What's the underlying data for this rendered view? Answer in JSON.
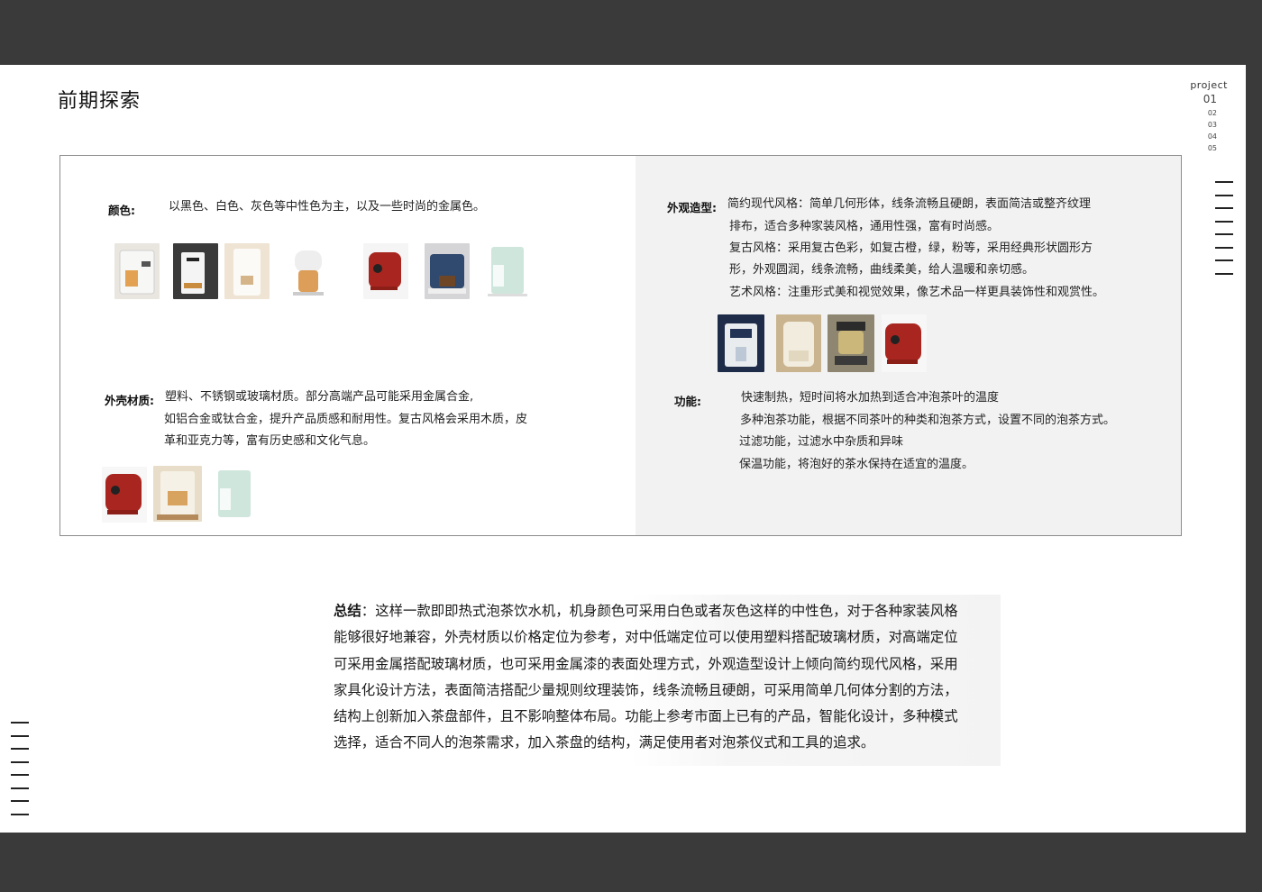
{
  "page": {
    "title": "前期探索"
  },
  "nav": {
    "label": "project",
    "numbers": [
      "01",
      "02",
      "03",
      "04",
      "05"
    ],
    "active": "01"
  },
  "color_section": {
    "label": "颜色:",
    "text": "以黑色、白色、灰色等中性色为主，以及一些时尚的金属色。"
  },
  "shell_section": {
    "label": "外壳材质:",
    "lines": [
      "塑料、不锈钢或玻璃材质。部分高端产品可能采用金属合金,",
      "如铝合金或钛合金，提升产品质感和耐用性。复古风格会采用木质，皮",
      "革和亚克力等，富有历史感和文化气息。"
    ]
  },
  "shape_section": {
    "label": "外观造型:",
    "lines": [
      "简约现代风格：简单几何形体，线条流畅且硬朗，表面简洁或整齐纹理",
      "排布，适合多种家装风格，通用性强，富有时尚感。",
      "复古风格：采用复古色彩，如复古橙，绿，粉等，采用经典形状圆形方",
      "形，外观圆润，线条流畅，曲线柔美，给人温暖和亲切感。",
      "艺术风格：注重形式美和视觉效果，像艺术品一样更具装饰性和观赏性。"
    ]
  },
  "function_section": {
    "label": "功能:",
    "lines": [
      "快速制热，短时间将水加热到适合冲泡茶叶的温度",
      "多种泡茶功能，根据不同茶叶的种类和泡茶方式，设置不同的泡茶方式。",
      "过滤功能，过滤水中杂质和异味",
      "保温功能，将泡好的茶水保持在适宜的温度。"
    ]
  },
  "summary": {
    "label": "总结",
    "lines": [
      "：这样一款即即热式泡茶饮水机，机身颜色可采用白色或者灰色这样的中性色，对于各种家装风格",
      "能够很好地兼容，外壳材质以价格定位为参考，对中低端定位可以使用塑料搭配玻璃材质，对高端定位",
      "可采用金属搭配玻璃材质，也可采用金属漆的表面处理方式，外观造型设计上倾向简约现代风格，采用",
      "家具化设计方法，表面简洁搭配少量规则纹理装饰，线条流畅且硬朗，可采用简单几何体分割的方法，",
      "结构上创新加入茶盘部件，且不影响整体布局。功能上参考市面上已有的产品，智能化设计，多种模式",
      "选择，适合不同人的泡茶需求，加入茶盘的结构，满足使用者对泡茶仪式和工具的追求。"
    ]
  },
  "colors": {
    "accent_red": "#a8261f",
    "mint": "#cfe6dc",
    "navy": "#2f4a6e",
    "panel_gray": "#f2f2f2"
  }
}
